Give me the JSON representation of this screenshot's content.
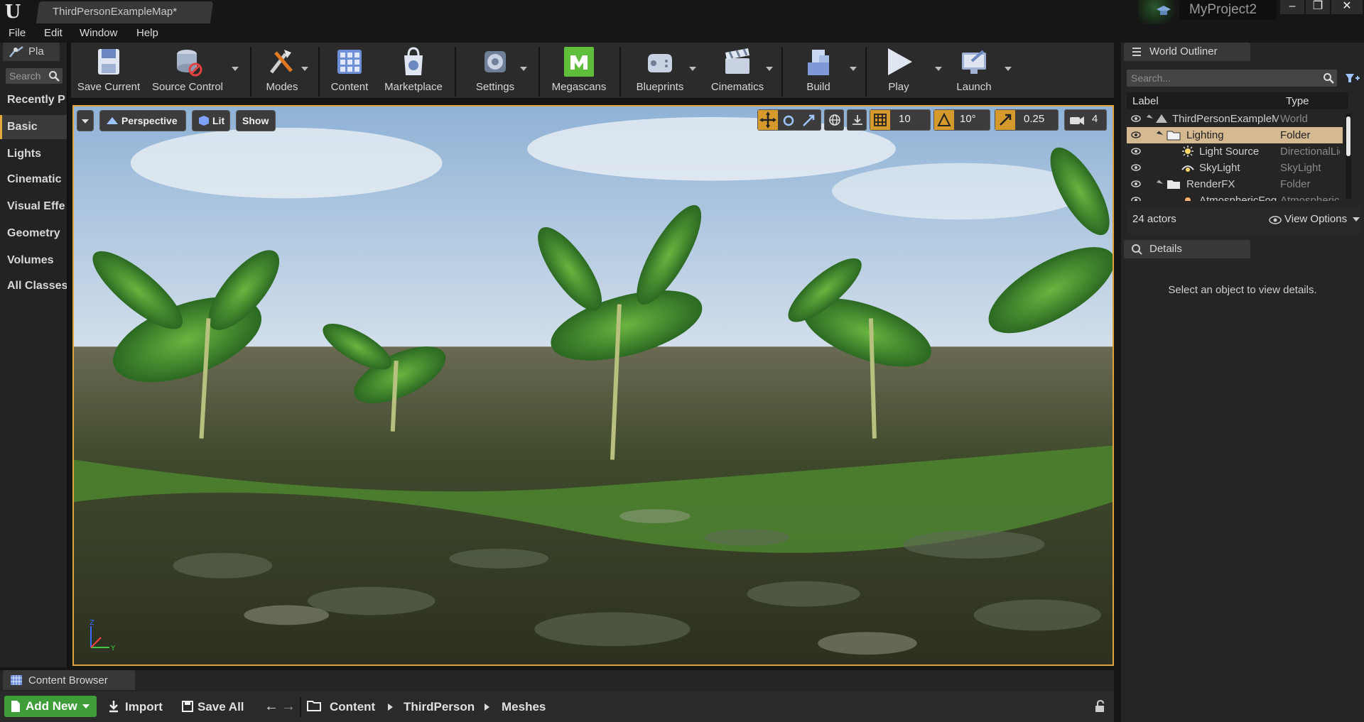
{
  "window": {
    "doc_tab": "ThirdPersonExampleMap*",
    "project_name": "MyProject2"
  },
  "menu": [
    "File",
    "Edit",
    "Window",
    "Help"
  ],
  "modes": {
    "tab_label": "Pla",
    "search_placeholder": "Search",
    "categories": [
      "Recently P",
      "Basic",
      "Lights",
      "Cinematic",
      "Visual Effe",
      "Geometry",
      "Volumes",
      "All Classes"
    ],
    "active_category": "Basic"
  },
  "toolbar": {
    "buttons": [
      {
        "label": "Save Current",
        "icon": "save-icon"
      },
      {
        "label": "Source Control",
        "icon": "source-control-icon"
      },
      {
        "label": "Modes",
        "icon": "modes-icon"
      },
      {
        "label": "Content",
        "icon": "content-icon"
      },
      {
        "label": "Marketplace",
        "icon": "marketplace-icon"
      },
      {
        "label": "Settings",
        "icon": "settings-icon"
      },
      {
        "label": "Megascans",
        "icon": "megascans-icon"
      },
      {
        "label": "Blueprints",
        "icon": "blueprints-icon"
      },
      {
        "label": "Cinematics",
        "icon": "cinematics-icon"
      },
      {
        "label": "Build",
        "icon": "build-icon"
      },
      {
        "label": "Play",
        "icon": "play-icon"
      },
      {
        "label": "Launch",
        "icon": "launch-icon"
      }
    ]
  },
  "viewport": {
    "perspective": "Perspective",
    "lit": "Lit",
    "show": "Show",
    "grid_snap": "10",
    "rotation_snap": "10°",
    "scale_snap": "0.25",
    "camera_speed": "4"
  },
  "outliner": {
    "tab_label": "World Outliner",
    "search_placeholder": "Search...",
    "col_label": "Label",
    "col_type": "Type",
    "rows": [
      {
        "label": "ThirdPersonExampleMap",
        "type": "World"
      },
      {
        "label": "Lighting",
        "type": "Folder"
      },
      {
        "label": "Light Source",
        "type": "DirectionalLight"
      },
      {
        "label": "SkyLight",
        "type": "SkyLight"
      },
      {
        "label": "RenderFX",
        "type": "Folder"
      },
      {
        "label": "AtmosphericFog",
        "type": "AtmosphericFog"
      }
    ],
    "actor_count": "24 actors",
    "view_options": "View Options"
  },
  "details": {
    "tab_label": "Details",
    "empty_message": "Select an object to view details."
  },
  "content_browser": {
    "tab_label": "Content Browser",
    "add_new": "Add New",
    "import": "Import",
    "save_all": "Save All",
    "path": [
      "Content",
      "ThirdPerson",
      "Meshes"
    ]
  },
  "colors": {
    "accent": "#e0a33c",
    "selection": "#d4b991",
    "add_new": "#3f9e3a",
    "megascans": "#5fbf3a"
  }
}
